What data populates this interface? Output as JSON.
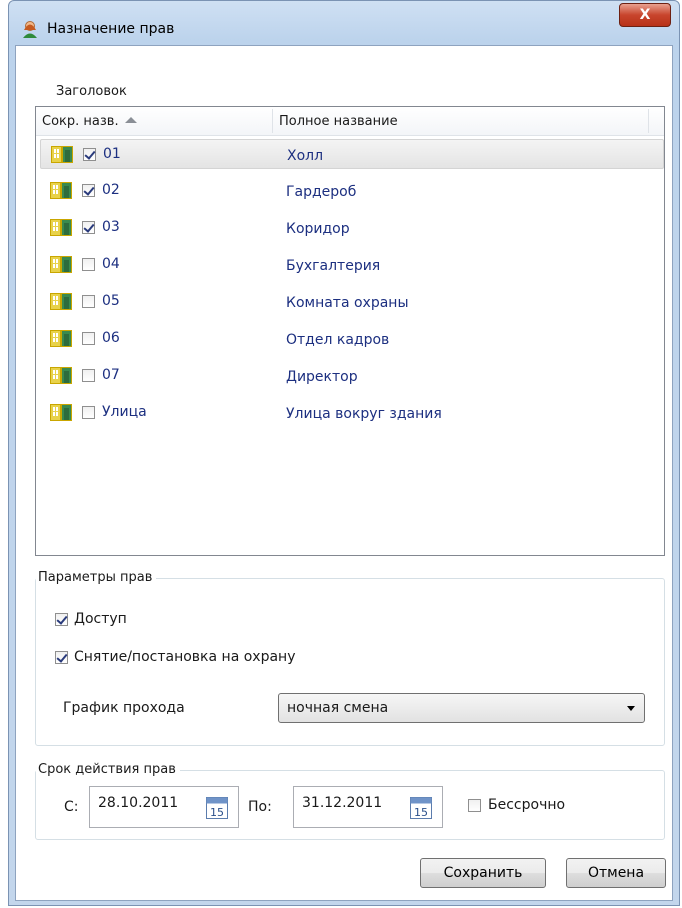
{
  "window": {
    "title": "Назначение прав",
    "close_glyph": "X"
  },
  "header_label": "Заголовок",
  "list": {
    "columns": {
      "short": "Сокр. назв.",
      "full": "Полное название"
    },
    "rows": [
      {
        "short": "01",
        "full": "Холл",
        "checked": true,
        "selected": true
      },
      {
        "short": "02",
        "full": "Гардероб",
        "checked": true
      },
      {
        "short": "03",
        "full": "Коридор",
        "checked": true
      },
      {
        "short": "04",
        "full": "Бухгалтерия",
        "checked": false
      },
      {
        "short": "05",
        "full": "Комната охраны",
        "checked": false
      },
      {
        "short": "06",
        "full": "Отдел кадров",
        "checked": false
      },
      {
        "short": "07",
        "full": "Директор",
        "checked": false
      },
      {
        "short": "Улица",
        "full": "Улица вокруг здания",
        "checked": false
      }
    ]
  },
  "rights": {
    "group_title": "Параметры прав",
    "access_label": "Доступ",
    "access_checked": true,
    "arm_label": "Снятие/постановка на охрану",
    "arm_checked": true,
    "schedule_label": "График прохода",
    "schedule_value": "ночная смена"
  },
  "validity": {
    "group_title": "Срок действия прав",
    "from_label": "С:",
    "from_value": "28.10.2011",
    "to_label": "По:",
    "to_value": "31.12.2011",
    "calendar_day": "15",
    "unlimited_label": "Бессрочно",
    "unlimited_checked": false
  },
  "buttons": {
    "save": "Сохранить",
    "cancel": "Отмена"
  },
  "colors": {
    "link_text": "#1c2f80",
    "close_button": "#c8452d",
    "frame": "#c3d6ec"
  }
}
